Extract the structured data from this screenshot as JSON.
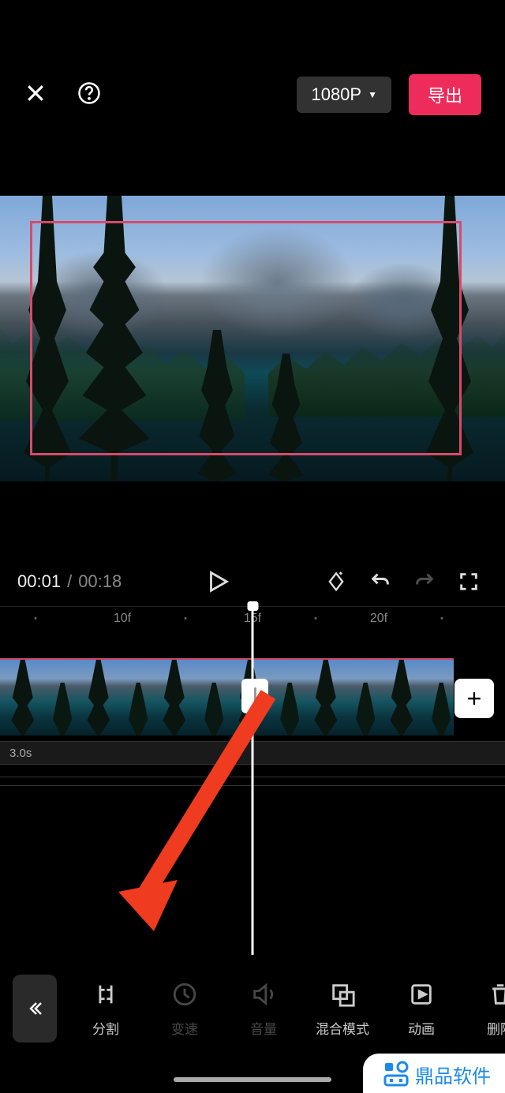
{
  "header": {
    "resolution": "1080P",
    "export_label": "导出"
  },
  "playback": {
    "current_time": "00:01",
    "separator": "/",
    "total_time": "00:18"
  },
  "ruler": {
    "marks": [
      "10f",
      "15f",
      "20f"
    ]
  },
  "timeline": {
    "track2_duration": "3.0s",
    "add_label": "+"
  },
  "toolbar": {
    "items": [
      {
        "label": "分割",
        "dim": false,
        "icon": "split"
      },
      {
        "label": "变速",
        "dim": true,
        "icon": "speed"
      },
      {
        "label": "音量",
        "dim": true,
        "icon": "volume"
      },
      {
        "label": "混合模式",
        "dim": false,
        "icon": "blend"
      },
      {
        "label": "动画",
        "dim": false,
        "icon": "anim"
      },
      {
        "label": "删除",
        "dim": false,
        "icon": "delete"
      }
    ]
  },
  "watermark": {
    "text": "鼎品软件"
  }
}
